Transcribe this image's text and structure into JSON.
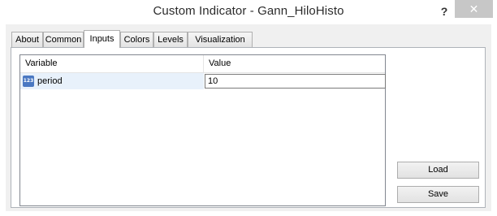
{
  "window": {
    "title": "Custom Indicator - Gann_HiloHisto",
    "help_label": "?",
    "close_label": "✕"
  },
  "tabs": [
    {
      "label": "About",
      "active": false
    },
    {
      "label": "Common",
      "active": false
    },
    {
      "label": "Inputs",
      "active": true
    },
    {
      "label": "Colors",
      "active": false
    },
    {
      "label": "Levels",
      "active": false
    },
    {
      "label": "Visualization",
      "active": false
    }
  ],
  "inputs_grid": {
    "columns": [
      "Variable",
      "Value"
    ],
    "rows": [
      {
        "icon": "numeric-type-icon",
        "icon_text": "123",
        "variable": "period",
        "value": "10"
      }
    ]
  },
  "buttons": {
    "load_label": "Load",
    "save_label": "Save"
  }
}
